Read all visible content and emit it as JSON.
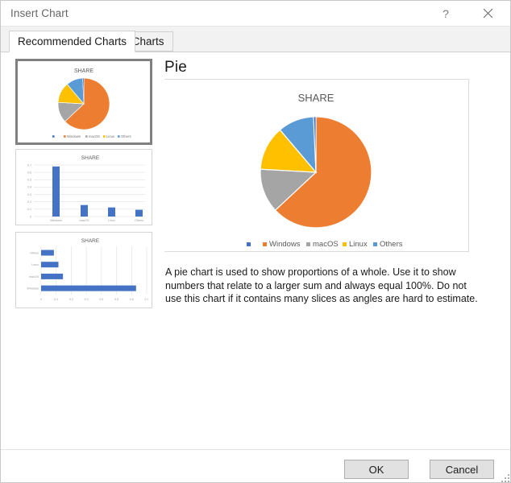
{
  "window": {
    "title": "Insert Chart",
    "help_label": "?",
    "close_label": "✕"
  },
  "tabs": [
    {
      "id": "recommended-charts",
      "label": "Recommended Charts",
      "active": true
    },
    {
      "id": "all-charts",
      "label": "All Charts",
      "active": false
    }
  ],
  "thumbnails": [
    {
      "id": "pie",
      "type": "pie",
      "title": "SHARE",
      "selected": true
    },
    {
      "id": "column",
      "type": "bar",
      "title": "SHARE",
      "selected": false
    },
    {
      "id": "bar",
      "type": "bar",
      "title": "SHARE",
      "selected": false
    }
  ],
  "preview": {
    "title": "Pie",
    "description": "A pie chart is used to show proportions of a whole. Use it to show numbers that relate to a larger sum and always equal 100%. Do not use this chart if it contains many slices as angles are hard to estimate."
  },
  "footer": {
    "ok_label": "OK",
    "cancel_label": "Cancel"
  },
  "colors": {
    "series_blue_dark": "#4472C4",
    "series_orange": "#ED7D31",
    "series_gray": "#A5A5A5",
    "series_yellow": "#FFC000",
    "series_blue": "#5B9BD5",
    "axis_text": "#595959",
    "gridline": "#D9D9D9"
  },
  "chart_data": {
    "type": "pie",
    "title": "SHARE",
    "categories": [
      "",
      "Windows",
      "macOS",
      "Linux",
      "Others"
    ],
    "values": [
      0,
      0.63,
      0.145,
      0.115,
      0.085
    ],
    "legend": [
      "",
      "Windows",
      "macOS",
      "Linux",
      "Others"
    ],
    "legend_position": "bottom",
    "colors": [
      "#4472C4",
      "#ED7D31",
      "#A5A5A5",
      "#FFC000",
      "#5B9BD5"
    ],
    "slices": [
      {
        "label": "Windows",
        "value": 0.63,
        "color": "#ED7D31"
      },
      {
        "label": "macOS",
        "value": 0.145,
        "color": "#A5A5A5"
      },
      {
        "label": "Linux",
        "value": 0.115,
        "color": "#FFC000"
      },
      {
        "label": "Others",
        "value": 0.085,
        "color": "#5B9BD5"
      }
    ]
  },
  "alt_charts": [
    {
      "type": "bar",
      "orientation": "vertical",
      "title": "SHARE",
      "categories": [
        "Windows",
        "macOS",
        "Linux",
        "Others"
      ],
      "values": [
        0.63,
        0.145,
        0.115,
        0.085
      ],
      "yticks": [
        "0",
        "0.1",
        "0.2",
        "0.3",
        "0.4",
        "0.5",
        "0.6",
        "0.7"
      ],
      "ylim": [
        0,
        0.7
      ],
      "color": "#4472C4"
    },
    {
      "type": "bar",
      "orientation": "horizontal",
      "title": "SHARE",
      "categories": [
        "Windows",
        "macOS",
        "Linux",
        "Others"
      ],
      "values": [
        0.63,
        0.145,
        0.115,
        0.085
      ],
      "xticks": [
        "0",
        "0.1",
        "0.2",
        "0.3",
        "0.4",
        "0.5",
        "0.6",
        "0.7"
      ],
      "xlim": [
        0,
        0.7
      ],
      "color": "#4472C4"
    }
  ]
}
